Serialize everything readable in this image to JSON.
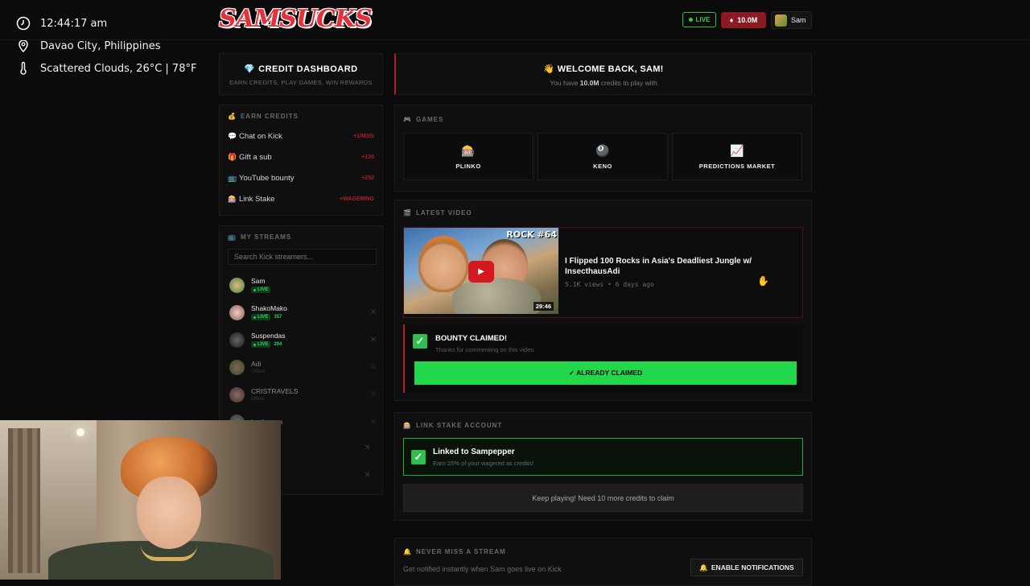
{
  "overlay": {
    "time": "12:44:17 am",
    "location": "Davao City, Philippines",
    "weather": "Scattered Clouds, 26°C | 78°F"
  },
  "header": {
    "logo": "SAMSUCKS",
    "live_label": "LIVE",
    "credits": "10.0M",
    "user": "Sam"
  },
  "credit_dashboard": {
    "title": "CREDIT DASHBOARD",
    "icon": "💎",
    "subtitle": "EARN CREDITS, PLAY GAMES, WIN REWARDS"
  },
  "earn_credits": {
    "title": "EARN CREDITS",
    "icon": "💰",
    "items": [
      {
        "icon": "💬",
        "label": "Chat on Kick",
        "value": "+1/MSG"
      },
      {
        "icon": "🎁",
        "label": "Gift a sub",
        "value": "+100"
      },
      {
        "icon": "📺",
        "label": "YouTube bounty",
        "value": "+250"
      },
      {
        "icon": "🎰",
        "label": "Link Stake",
        "value": "+WAGERING"
      }
    ]
  },
  "my_streams": {
    "title": "MY STREAMS",
    "icon": "📺",
    "search_placeholder": "Search Kick streamers...",
    "live_label": "LIVE",
    "offline_label": "Offline",
    "items": [
      {
        "name": "Sam",
        "status": "live",
        "viewers": ""
      },
      {
        "name": "ShakoMako",
        "status": "live",
        "viewers": "357"
      },
      {
        "name": "Suspendas",
        "status": "live",
        "viewers": "204"
      },
      {
        "name": "Adi",
        "status": "offline",
        "viewers": ""
      },
      {
        "name": "CRISTRAVELS",
        "status": "offline",
        "viewers": ""
      },
      {
        "name": "hyubsama",
        "status": "",
        "viewers": ""
      }
    ]
  },
  "welcome": {
    "title": "WELCOME BACK, SAM!",
    "icon": "👋",
    "sub_prefix": "You have",
    "sub_amount": "10.0M",
    "sub_suffix": "credits to play with"
  },
  "games": {
    "title": "GAMES",
    "icon": "🎮",
    "items": [
      {
        "icon": "🎰",
        "label": "PLINKO"
      },
      {
        "icon": "🎱",
        "label": "KENO"
      },
      {
        "icon": "📈",
        "label": "PREDICTIONS MARKET"
      }
    ]
  },
  "latest_video": {
    "title": "LATEST VIDEO",
    "icon": "🎬",
    "thumb_text": "ROCK #64",
    "duration": "29:46",
    "video_title": "I Flipped 100 Rocks in Asia's Deadliest Jungle w/ InsecthausAdi",
    "meta": "5.1K views • 6 days ago"
  },
  "bounty": {
    "title": "BOUNTY CLAIMED!",
    "subtitle": "Thanks for commenting on this video",
    "button": "✓ ALREADY CLAIMED"
  },
  "link_stake": {
    "title": "LINK STAKE ACCOUNT",
    "icon": "🎰",
    "linked": "Linked to Sampepper",
    "linked_sub": "Earn 25% of your wagered as credits!",
    "keep_button": "Keep playing! Need 10 more credits to claim"
  },
  "never_miss": {
    "title": "NEVER MISS A STREAM",
    "icon": "🔔",
    "subtitle": "Get notified instantly when Sam goes live on Kick",
    "button": "ENABLE NOTIFICATIONS",
    "button_icon": "🔔"
  },
  "colors": {
    "accent_red": "#b01e28",
    "live_green": "#29d050",
    "claim_green": "#22d84a"
  }
}
